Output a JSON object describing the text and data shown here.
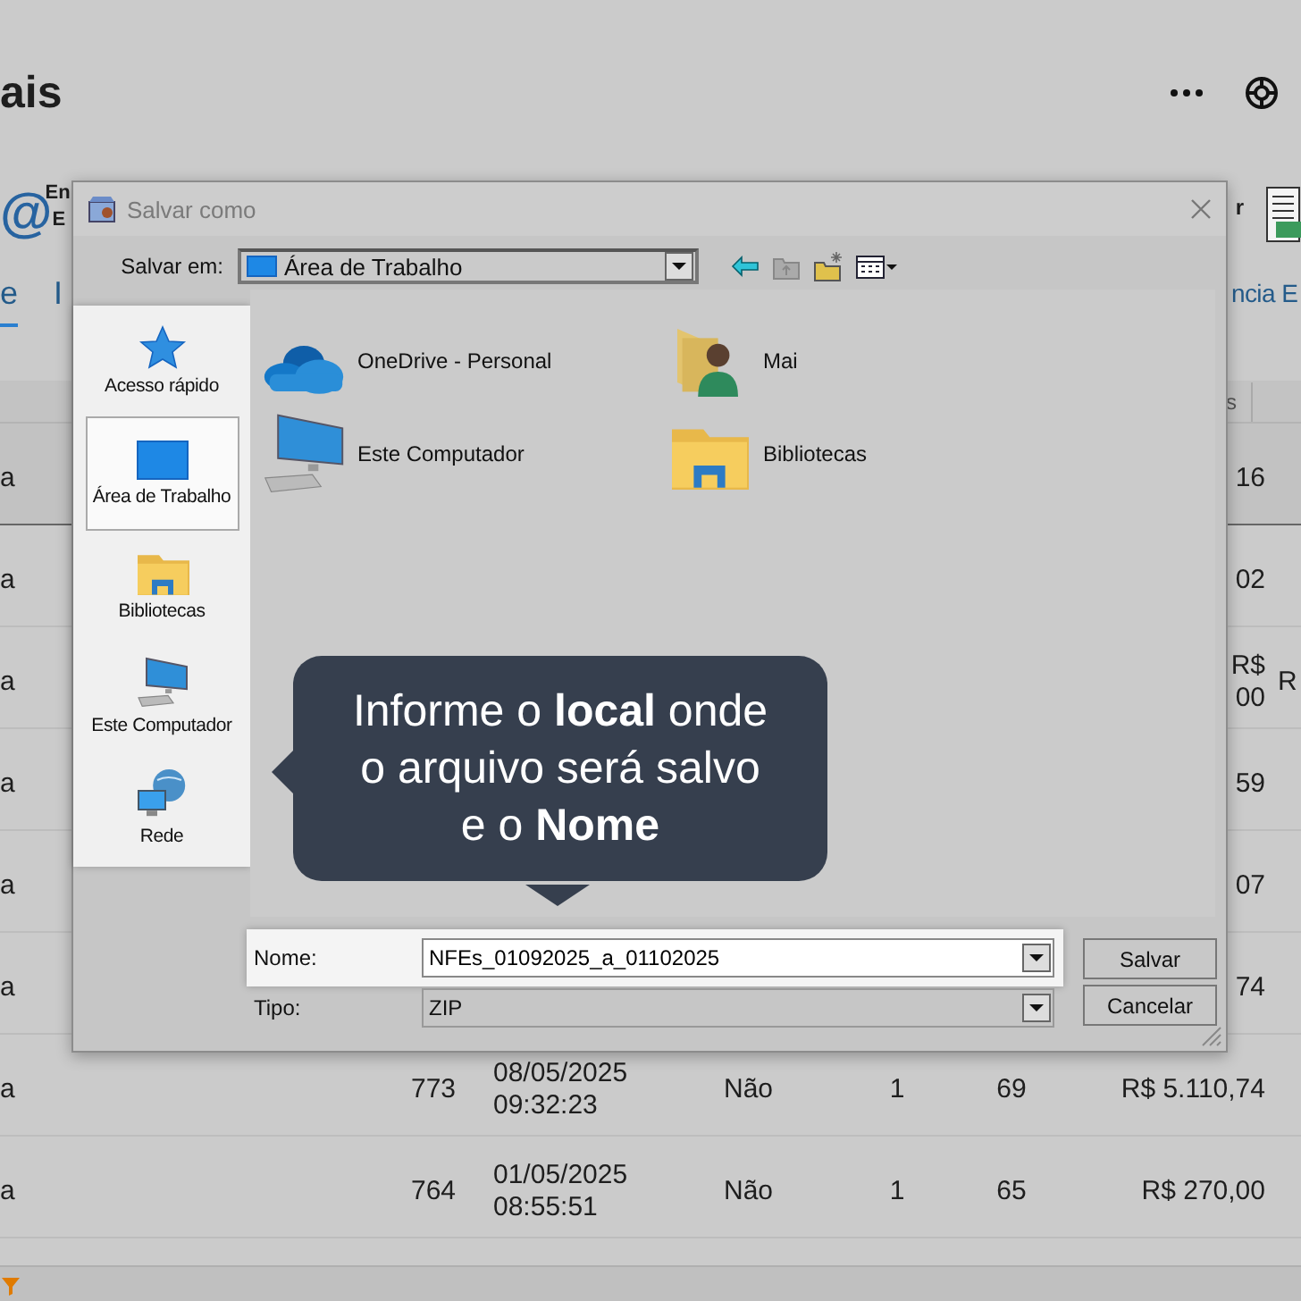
{
  "app": {
    "title": "ais",
    "ribbon": {
      "icon_text": "@",
      "left_lines": [
        "En",
        "E"
      ],
      "right_text": "r"
    },
    "tabs": [
      {
        "label": "e",
        "selected": true
      },
      {
        "label": "I",
        "selected": false
      },
      {
        "label": "ncia E",
        "selected": false
      }
    ],
    "table": {
      "header": "s",
      "rows": [
        {
          "selected": true,
          "column_1": "a",
          "column_7": "16"
        },
        {
          "selected": false,
          "column_1": "a",
          "column_7": "02"
        },
        {
          "selected": false,
          "column_1": "a",
          "column_7": "R$\n00",
          "column_8": "R"
        },
        {
          "selected": false,
          "column_1": "a",
          "column_7": "59"
        },
        {
          "selected": false,
          "column_1": "a",
          "column_7": "07"
        },
        {
          "selected": false,
          "column_1": "a",
          "column_7": "74"
        },
        {
          "selected": false,
          "column_1": "a",
          "column_2": "773",
          "column_3": "08/05/2025\n09:32:23",
          "column_4": "Não",
          "column_5": "1",
          "column_6": "69",
          "column_7": "R$ 5.110,74"
        },
        {
          "selected": false,
          "column_1": "a",
          "column_2": "764",
          "column_3": "01/05/2025\n08:55:51",
          "column_4": "Não",
          "column_5": "1",
          "column_6": "65",
          "column_7": "R$ 270,00"
        }
      ]
    }
  },
  "dialog": {
    "title": "Salvar como",
    "location_label": "Salvar em:",
    "location": "Área de Trabalho",
    "places": [
      {
        "kind": "quick-access",
        "label": "Acesso rápido",
        "selected": false
      },
      {
        "kind": "desktop",
        "label": "Área de Trabalho",
        "selected": true
      },
      {
        "kind": "libraries",
        "label": "Bibliotecas",
        "selected": false
      },
      {
        "kind": "computer",
        "label": "Este Computador",
        "selected": false
      },
      {
        "kind": "network",
        "label": "Rede",
        "selected": false
      }
    ],
    "items": [
      {
        "kind": "cloud",
        "label": "OneDrive - Personal"
      },
      {
        "kind": "user-folder",
        "label": "Mai"
      },
      {
        "kind": "computer",
        "label": "Este Computador"
      },
      {
        "kind": "libraries",
        "label": "Bibliotecas"
      }
    ],
    "callout": "Informe o **local** onde o arquivo será salvo e o **Nome**",
    "name_label": "Nome:",
    "name_value": "NFEs_01092025_a_01102025",
    "type_label": "Tipo:",
    "type_value": "ZIP",
    "buttons": [
      "Salvar",
      "Cancelar"
    ]
  }
}
